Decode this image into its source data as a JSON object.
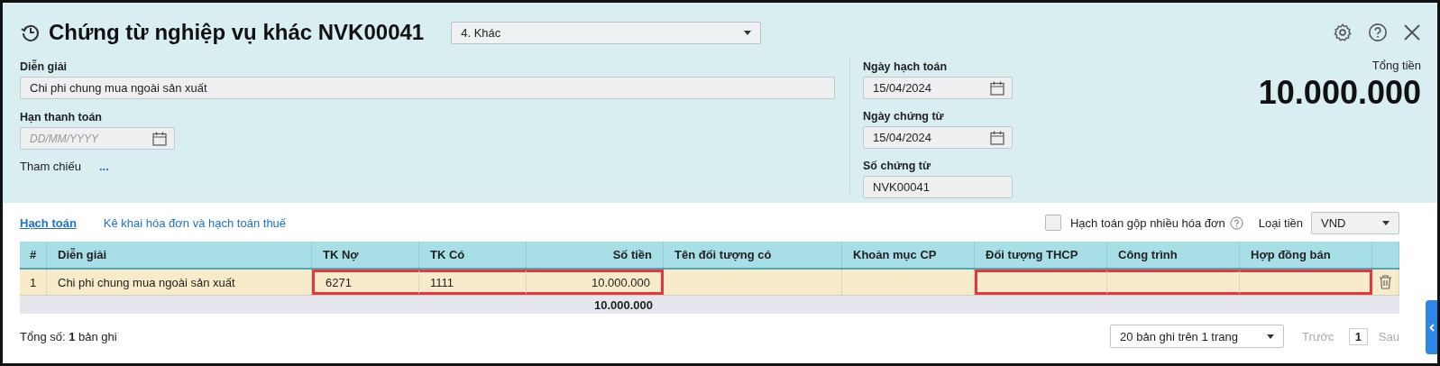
{
  "header": {
    "title": "Chứng từ nghiệp vụ khác NVK00041",
    "type_select": {
      "value": "4. Khác"
    }
  },
  "form": {
    "description": {
      "label": "Diễn giải",
      "value": "Chi phi chung mua ngoài sản xuất"
    },
    "due_date": {
      "label": "Hạn thanh toán",
      "placeholder": "DD/MM/YYYY"
    },
    "reference": {
      "label": "Tham chiếu",
      "link": "..."
    },
    "posting_date": {
      "label": "Ngày hạch toán",
      "value": "15/04/2024"
    },
    "voucher_date": {
      "label": "Ngày chứng từ",
      "value": "15/04/2024"
    },
    "voucher_no": {
      "label": "Số chứng từ",
      "value": "NVK00041"
    },
    "total": {
      "label": "Tổng tiền",
      "value": "10.000.000"
    }
  },
  "tabs": [
    {
      "label": "Hạch toán",
      "selected": true
    },
    {
      "label": "Kê khai hóa đơn và hạch toán thuế",
      "selected": false
    }
  ],
  "merge_invoices": {
    "label": "Hạch toán gộp nhiều hóa đơn",
    "checked": false
  },
  "currency": {
    "label": "Loại tiền",
    "value": "VND"
  },
  "table": {
    "columns": [
      {
        "label": "#",
        "kind": "index",
        "highlighted": false
      },
      {
        "label": "Diễn giải",
        "kind": "text",
        "highlighted": false
      },
      {
        "label": "TK Nợ",
        "kind": "text",
        "highlighted": true
      },
      {
        "label": "TK Có",
        "kind": "text",
        "highlighted": true
      },
      {
        "label": "Số tiền",
        "kind": "amount",
        "highlighted": true,
        "total": "10.000.000"
      },
      {
        "label": "Tên đối tượng có",
        "kind": "text",
        "highlighted": false
      },
      {
        "label": "Khoản mục CP",
        "kind": "text",
        "highlighted": false
      },
      {
        "label": "Đối tượng THCP",
        "kind": "text",
        "highlighted": true
      },
      {
        "label": "Công trình",
        "kind": "text",
        "highlighted": true
      },
      {
        "label": "Hợp đồng bán",
        "kind": "text",
        "highlighted": true
      }
    ],
    "rows": [
      {
        "cells": [
          "1",
          "Chi phi chung mua ngoài sản xuất",
          "6271",
          "1111",
          "10.000.000",
          "",
          "",
          "",
          "",
          ""
        ]
      }
    ]
  },
  "footer": {
    "record_count": "Tổng số: **1** bản ghi",
    "page_size": "20 bản ghi trên 1 trang",
    "prev": "Trước",
    "page": "1",
    "next": "Sau"
  }
}
